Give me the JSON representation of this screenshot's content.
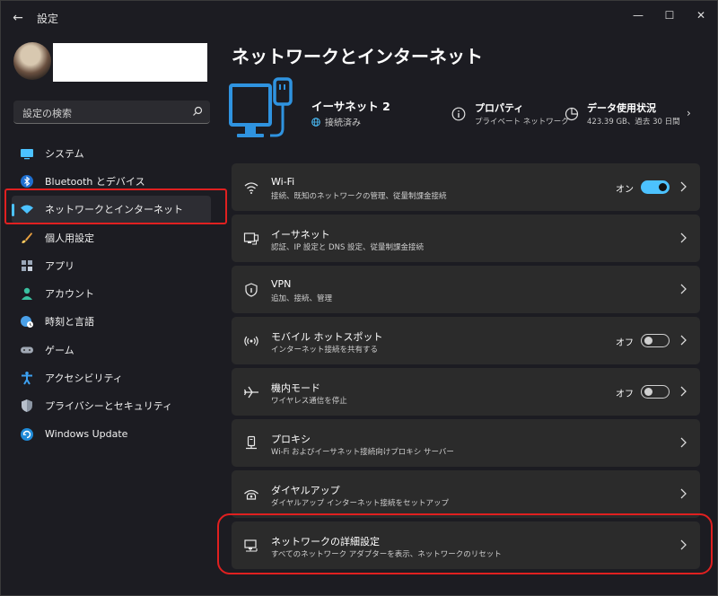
{
  "app": {
    "title": "設定"
  },
  "user": {
    "name": ""
  },
  "search": {
    "placeholder": "設定の検索"
  },
  "sidebar": {
    "items": [
      {
        "label": "システム",
        "icon": "monitor-icon"
      },
      {
        "label": "Bluetooth とデバイス",
        "icon": "bluetooth-icon"
      },
      {
        "label": "ネットワークとインターネット",
        "icon": "wifi-icon",
        "active": true
      },
      {
        "label": "個人用設定",
        "icon": "brush-icon"
      },
      {
        "label": "アプリ",
        "icon": "apps-icon"
      },
      {
        "label": "アカウント",
        "icon": "person-icon"
      },
      {
        "label": "時刻と言語",
        "icon": "globe-clock-icon"
      },
      {
        "label": "ゲーム",
        "icon": "gamepad-icon"
      },
      {
        "label": "アクセシビリティ",
        "icon": "accessibility-icon"
      },
      {
        "label": "プライバシーとセキュリティ",
        "icon": "shield-icon"
      },
      {
        "label": "Windows Update",
        "icon": "update-icon"
      }
    ]
  },
  "main": {
    "title": "ネットワークとインターネット",
    "connection": {
      "name": "イーサネット 2",
      "status": "接続済み"
    },
    "properties": {
      "title": "プロパティ",
      "sub": "プライベート ネットワーク"
    },
    "data_usage": {
      "title": "データ使用状況",
      "sub": "423.39 GB、過去 30 日間"
    },
    "cards": [
      {
        "title": "Wi-Fi",
        "sub": "接続、既知のネットワークの管理、従量制課金接続",
        "toggle": "オン",
        "icon": "wifi-icon"
      },
      {
        "title": "イーサネット",
        "sub": "認証、IP 設定と DNS 設定、従量制課金接続",
        "icon": "ethernet-icon"
      },
      {
        "title": "VPN",
        "sub": "追加、接続、管理",
        "icon": "vpn-shield-icon"
      },
      {
        "title": "モバイル ホットスポット",
        "sub": "インターネット接続を共有する",
        "toggle": "オフ",
        "icon": "hotspot-icon"
      },
      {
        "title": "機内モード",
        "sub": "ワイヤレス通信を停止",
        "toggle": "オフ",
        "icon": "airplane-icon"
      },
      {
        "title": "プロキシ",
        "sub": "Wi-Fi およびイーサネット接続向けプロキシ サーバー",
        "icon": "proxy-icon"
      },
      {
        "title": "ダイヤルアップ",
        "sub": "ダイヤルアップ インターネット接続をセットアップ",
        "icon": "dialup-icon"
      },
      {
        "title": "ネットワークの詳細設定",
        "sub": "すべてのネットワーク アダプターを表示、ネットワークのリセット",
        "icon": "advanced-network-icon"
      }
    ]
  },
  "colors": {
    "accent": "#4cc2ff",
    "highlight": "#e02020",
    "card": "#2b2b2b",
    "background": "#1c1c22"
  }
}
